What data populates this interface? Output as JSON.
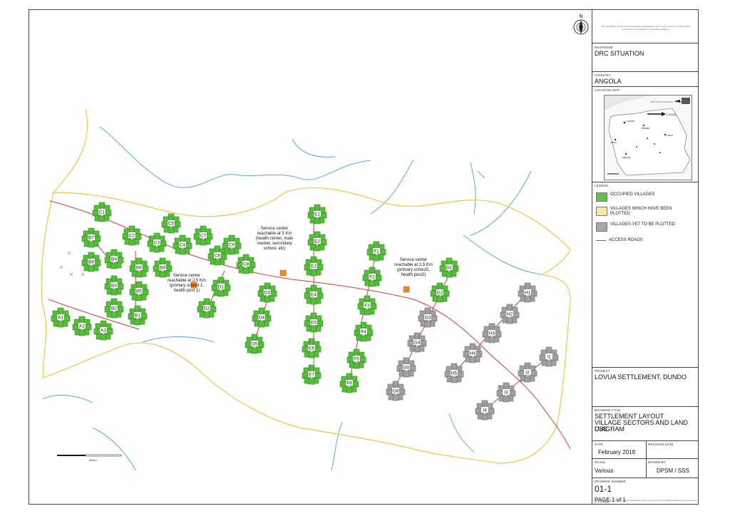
{
  "panel": {
    "header_note": "The boundaries and names shown and the designations used on this map do not imply official endorsement or acceptance by the United Nations.",
    "response_label": "RESPONSE",
    "response_value": "DRC SITUATION",
    "country_label": "COUNTRY",
    "country_value": "ANGOLA",
    "location_map_label": "LOCATION MAP",
    "legend_label": "LEGEND",
    "project_label": "PROJECT",
    "project_value": "LOVUA SETTLEMENT, DUNDO",
    "drawing_title_label": "DRAWING TITLE",
    "drawing_title_line1": "SETTLEMENT LAYOUT",
    "drawing_title_line2": "VILLAGE SECTORS  AND LAND USE",
    "drawing_title_line3": "DIAGRAM",
    "date_label": "DATE",
    "date_value": "February 2018",
    "revision_label": "REVISION DATE",
    "scale_label": "SCALE",
    "scale_value": "Various",
    "drawn_by_label": "DRAWN BY",
    "drawn_by_value": "DPSM / SSS",
    "drawing_number_label": "DRAWING NUMBER",
    "drawing_number_value": "01-1",
    "page_value": "PAGE 1 of 1",
    "footer_note": "The boundaries and names shown and the designations used on this map do not imply official endorsement or acceptance by the United Nations."
  },
  "legend": {
    "occupied": "OCCUPIED VILLAGES",
    "plotted": "VILLAGES WHICH HAVE BEEN PLOTTED",
    "yet": "VILLAGES YET TO BE PLOTTED",
    "roads": "ACCESS ROADS"
  },
  "inset": {
    "label_lovua": "LOVUA",
    "label_luanda": "Luanda",
    "label_malanje": "Malanje",
    "label_lobito": "Lobito",
    "label_lubango": "Lubango",
    "label_luena": "Luena",
    "label_drc": "DEMOCRATIC REPUBLIC OF THE CONGO"
  },
  "map": {
    "north": "N",
    "scale_label": "Metres",
    "colors": {
      "occupied_fill": "#5cc43e",
      "yet_fill": "#9e9e9e",
      "boundary": "#f5c542",
      "road": "#e23b3b",
      "river": "#5aa9e6",
      "service": "#f08a1a"
    },
    "service_centers": [
      {
        "line1": "Service center",
        "line2": "reachable at 2.5 Km",
        "line3": "(primary school 1,",
        "line4": "health post 1)"
      },
      {
        "line1": "Service center",
        "line2": "reachable at 5 Km",
        "line3": "(health center, main",
        "line4": "market, secondary",
        "line5": "school, etc)"
      },
      {
        "line1": "Service center",
        "line2": "reachable at 2.5 Km",
        "line3": "(primary school2,",
        "line4": "health post2)"
      }
    ],
    "villages": [
      {
        "id": "A1",
        "s": "o"
      },
      {
        "id": "A2",
        "s": "o"
      },
      {
        "id": "A3",
        "s": "o"
      },
      {
        "id": "B1",
        "s": "o"
      },
      {
        "id": "B2",
        "s": "o"
      },
      {
        "id": "B3",
        "s": "o"
      },
      {
        "id": "B4",
        "s": "o"
      },
      {
        "id": "B5",
        "s": "o"
      },
      {
        "id": "B6",
        "s": "o"
      },
      {
        "id": "B7",
        "s": "o"
      },
      {
        "id": "B8",
        "s": "o"
      },
      {
        "id": "B9",
        "s": "o"
      },
      {
        "id": "C1",
        "s": "o"
      },
      {
        "id": "C2",
        "s": "o"
      },
      {
        "id": "C3",
        "s": "o"
      },
      {
        "id": "C4",
        "s": "o"
      },
      {
        "id": "C5",
        "s": "o"
      },
      {
        "id": "C6",
        "s": "o"
      },
      {
        "id": "C7",
        "s": "o"
      },
      {
        "id": "C8",
        "s": "o"
      },
      {
        "id": "C9",
        "s": "o"
      },
      {
        "id": "D1",
        "s": "o"
      },
      {
        "id": "D2",
        "s": "o"
      },
      {
        "id": "D3",
        "s": "o"
      },
      {
        "id": "D4",
        "s": "o"
      },
      {
        "id": "D5",
        "s": "o"
      },
      {
        "id": "E1",
        "s": "o"
      },
      {
        "id": "E2",
        "s": "o"
      },
      {
        "id": "E3",
        "s": "o"
      },
      {
        "id": "E4",
        "s": "o"
      },
      {
        "id": "E5",
        "s": "o"
      },
      {
        "id": "E6",
        "s": "o"
      },
      {
        "id": "E7",
        "s": "o"
      },
      {
        "id": "F1",
        "s": "o"
      },
      {
        "id": "F2",
        "s": "o"
      },
      {
        "id": "F3",
        "s": "o"
      },
      {
        "id": "F4",
        "s": "o"
      },
      {
        "id": "F5",
        "s": "o"
      },
      {
        "id": "F6",
        "s": "o"
      },
      {
        "id": "G1",
        "s": "o"
      },
      {
        "id": "G2",
        "s": "o"
      },
      {
        "id": "G3",
        "s": "y"
      },
      {
        "id": "G4",
        "s": "y"
      },
      {
        "id": "G5",
        "s": "y"
      },
      {
        "id": "G6",
        "s": "y"
      },
      {
        "id": "H1",
        "s": "y"
      },
      {
        "id": "H2",
        "s": "y"
      },
      {
        "id": "H3",
        "s": "y"
      },
      {
        "id": "H4",
        "s": "y"
      },
      {
        "id": "H5",
        "s": "y"
      },
      {
        "id": "I1",
        "s": "y"
      },
      {
        "id": "I2",
        "s": "y"
      },
      {
        "id": "I3",
        "s": "y"
      },
      {
        "id": "I4",
        "s": "y"
      }
    ]
  }
}
